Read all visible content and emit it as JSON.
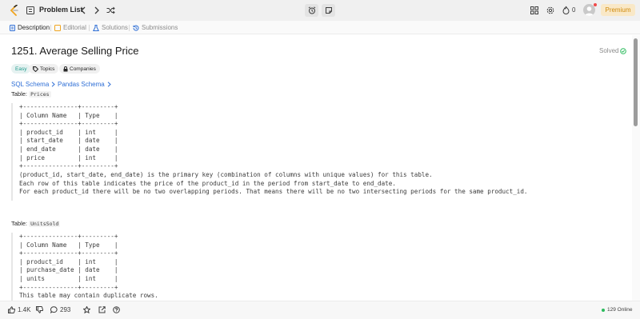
{
  "topbar": {
    "problem_list_label": "Problem List",
    "streak_count": "0",
    "premium_label": "Premium",
    "icons": [
      "logo-icon",
      "list-icon",
      "prev-icon",
      "next-icon",
      "shuffle-icon",
      "timer-icon",
      "notes-icon",
      "panel-icon",
      "settings-icon",
      "fire-icon",
      "avatar"
    ]
  },
  "tabs": [
    {
      "label": "Description",
      "icon": "description-icon",
      "active": true
    },
    {
      "label": "Editorial",
      "icon": "editorial-icon",
      "active": false
    },
    {
      "label": "Solutions",
      "icon": "solutions-icon",
      "active": false
    },
    {
      "label": "Submissions",
      "icon": "submissions-icon",
      "active": false
    }
  ],
  "problem": {
    "title": "1251. Average Selling Price",
    "solved_label": "Solved",
    "difficulty": "Easy",
    "topics_label": "Topics",
    "companies_label": "Companies",
    "schema_links": [
      "SQL Schema",
      "Pandas Schema"
    ]
  },
  "prices_table": {
    "label": "Table:",
    "name": "Prices",
    "lines": [
      "+---------------+---------+",
      "| Column Name   | Type    |",
      "+---------------+---------+",
      "| product_id    | int     |",
      "| start_date    | date    |",
      "| end_date      | date    |",
      "| price         | int     |",
      "+---------------+---------+",
      "(product_id, start_date, end_date) is the primary key (combination of columns with unique values) for this table.",
      "Each row of this table indicates the price of the product_id in the period from start_date to end_date.",
      "For each product_id there will be no two overlapping periods. That means there will be no two intersecting periods for the same product_id."
    ]
  },
  "units_table": {
    "label": "Table:",
    "name": "UnitsSold",
    "lines": [
      "+---------------+---------+",
      "| Column Name   | Type    |",
      "+---------------+---------+",
      "| product_id    | int     |",
      "| purchase_date | date    |",
      "| units         | int     |",
      "+---------------+---------+",
      "This table may contain duplicate rows."
    ]
  },
  "bottombar": {
    "likes": "1.4K",
    "comments": "293",
    "online": "129 Online"
  },
  "colors": {
    "accent": "#2f6fd6",
    "easy": "#1e9a8c",
    "premium": "#d08a0c",
    "online": "#2cbb5d"
  }
}
